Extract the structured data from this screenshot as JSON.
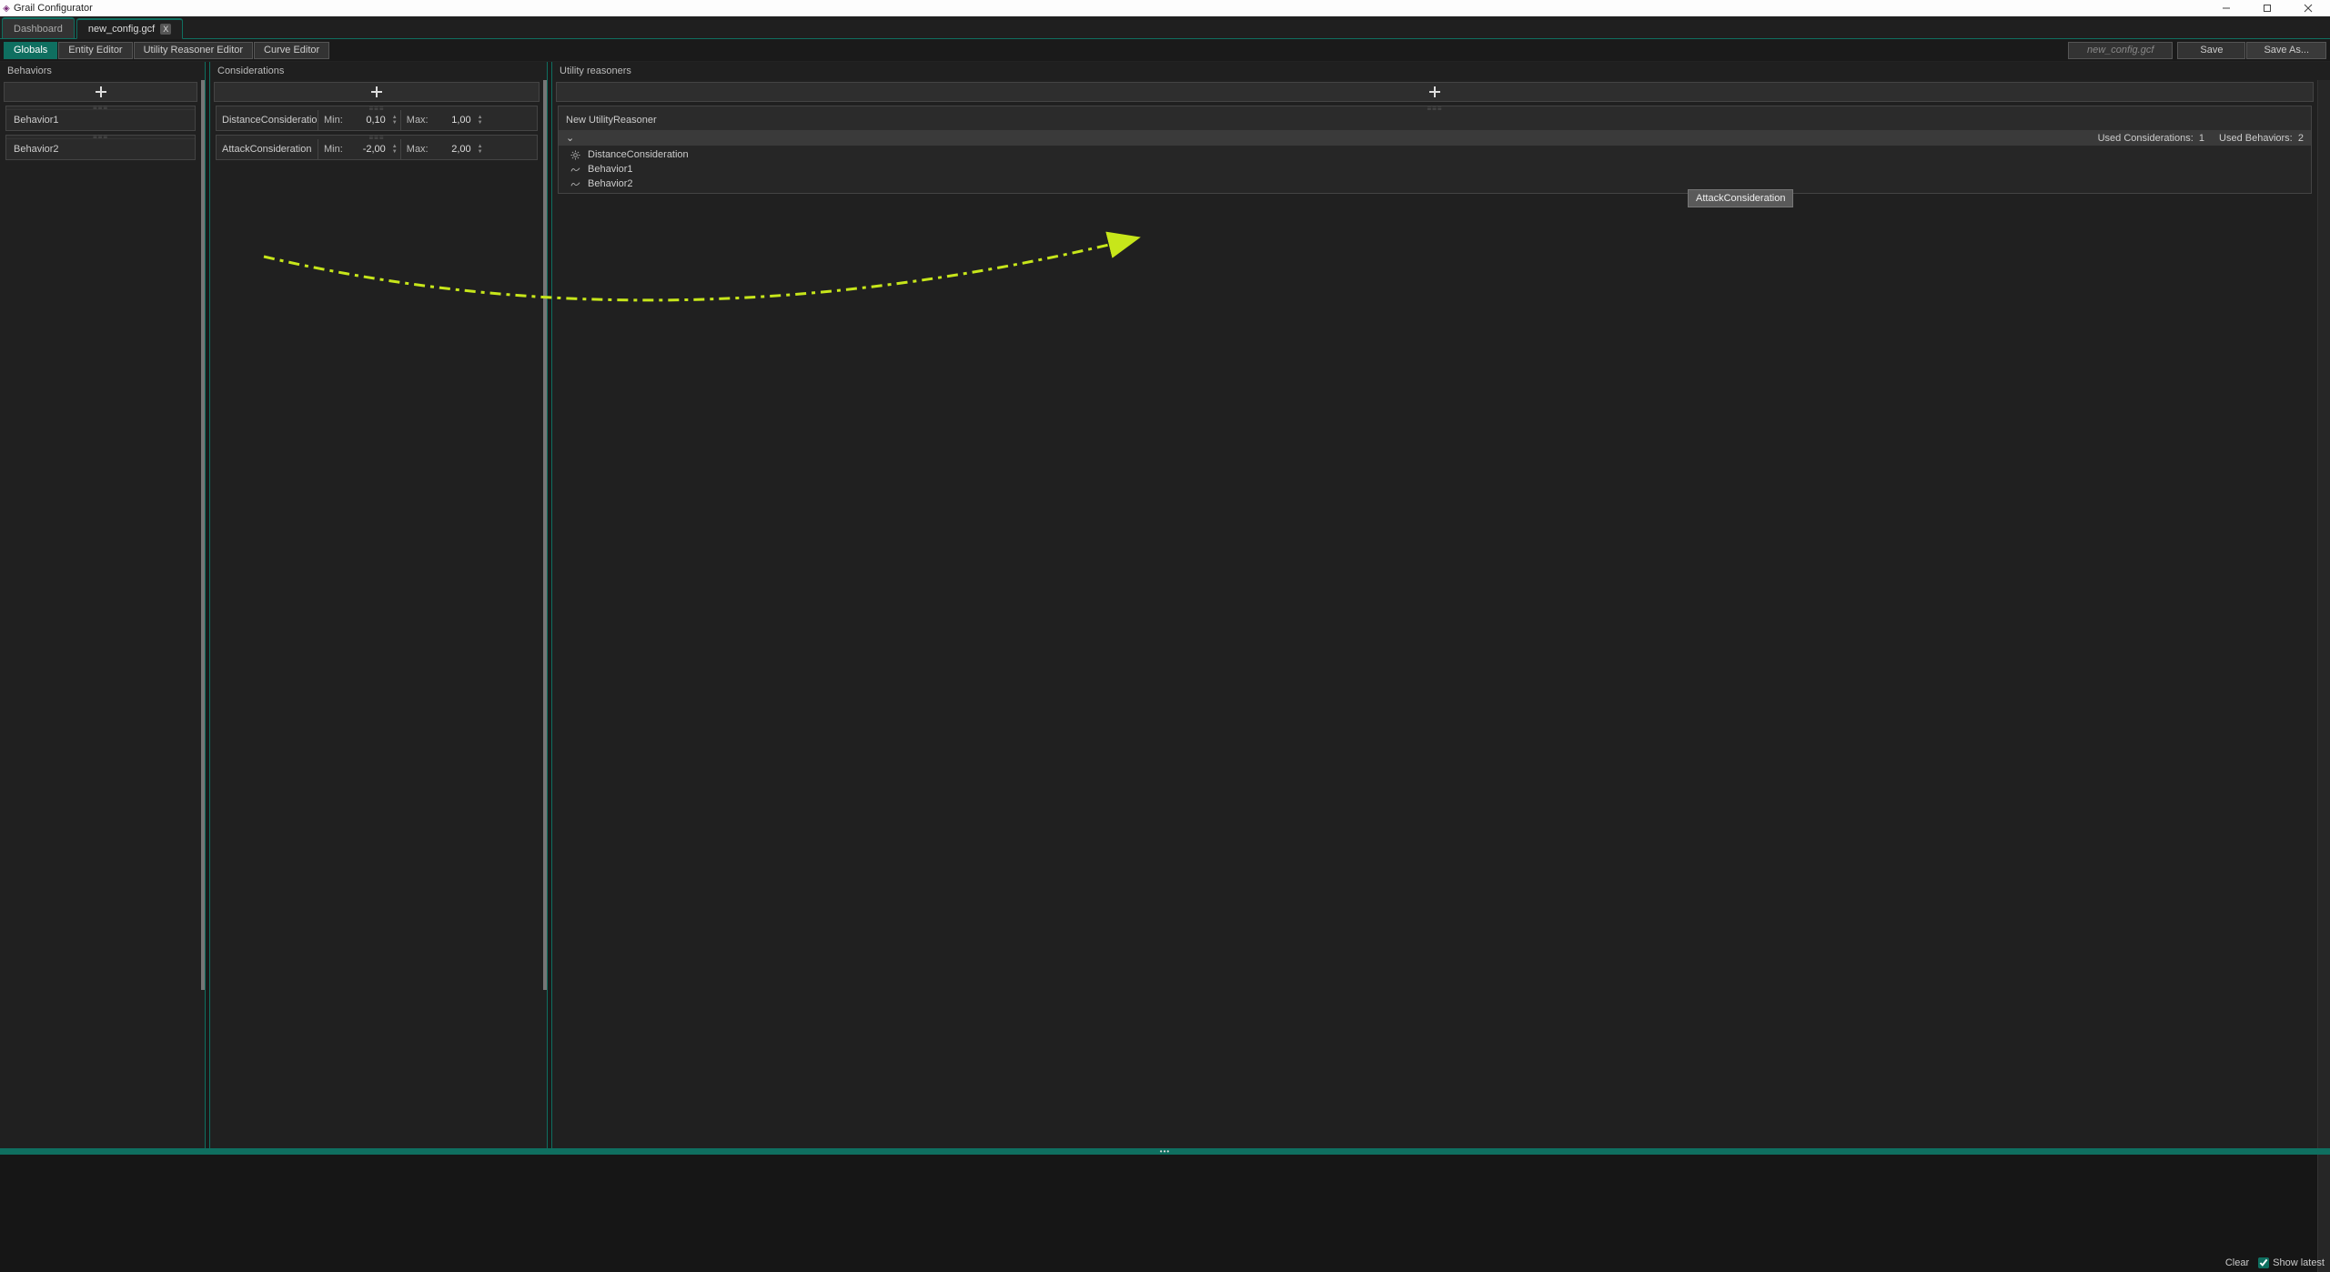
{
  "app": {
    "title": "Grail Configurator"
  },
  "tabs": {
    "dashboard": "Dashboard",
    "active_file": "new_config.gcf"
  },
  "toolbar": {
    "globals": "Globals",
    "entity_editor": "Entity Editor",
    "utility_reasoner_editor": "Utility Reasoner Editor",
    "curve_editor": "Curve Editor",
    "filename": "new_config.gcf",
    "save": "Save",
    "save_as": "Save As..."
  },
  "columns": {
    "behaviors": "Behaviors",
    "considerations": "Considerations",
    "utility_reasoners": "Utility reasoners"
  },
  "behaviors": [
    {
      "name": "Behavior1"
    },
    {
      "name": "Behavior2"
    }
  ],
  "considerations": [
    {
      "name": "DistanceConsideratio",
      "min_label": "Min:",
      "min": "0,10",
      "max_label": "Max:",
      "max": "1,00"
    },
    {
      "name": "AttackConsideration",
      "min_label": "Min:",
      "min": "-2,00",
      "max_label": "Max:",
      "max": "2,00"
    }
  ],
  "reasoners": [
    {
      "name": "New UtilityReasoner",
      "used_considerations_label": "Used Considerations:",
      "used_considerations": "1",
      "used_behaviors_label": "Used Behaviors:",
      "used_behaviors": "2",
      "items": [
        {
          "icon": "gear",
          "label": "DistanceConsideration"
        },
        {
          "icon": "wave",
          "label": "Behavior1"
        },
        {
          "icon": "wave",
          "label": "Behavior2"
        }
      ]
    }
  ],
  "drag_tooltip": "AttackConsideration",
  "log": {
    "clear": "Clear",
    "show_latest": "Show latest"
  }
}
